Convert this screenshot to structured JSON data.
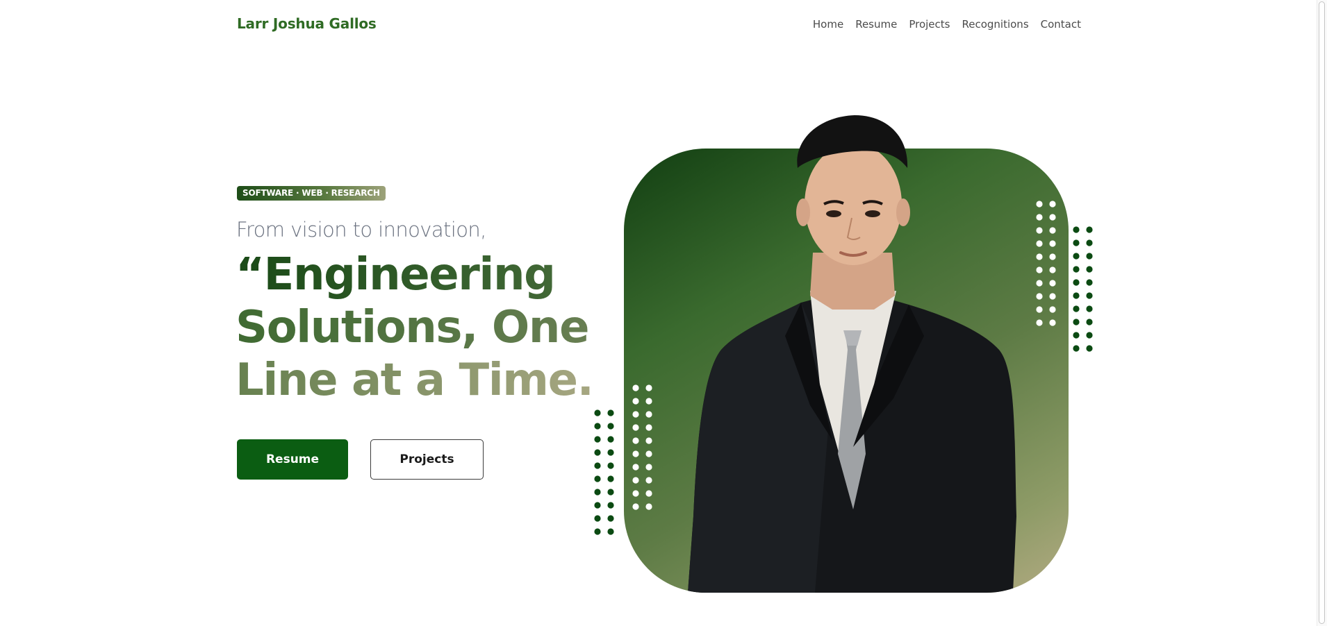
{
  "header": {
    "brand": "Larr Joshua Gallos",
    "nav": [
      "Home",
      "Resume",
      "Projects",
      "Recognitions",
      "Contact"
    ]
  },
  "hero": {
    "tag": "SOFTWARE · WEB · RESEARCH",
    "kicker": "From vision to innovation,",
    "headline": [
      "“Engineering",
      "Solutions, One",
      "Line at a Time.”"
    ],
    "buttons": {
      "primary": "Resume",
      "secondary": "Projects"
    }
  },
  "colors": {
    "brand": "#2f6b24",
    "primary_button": "#0b5d12",
    "card_gradient_start": "#123f12",
    "card_gradient_end": "#b2aa82",
    "dot_dark": "#0b4a12",
    "dot_light": "#ffffff"
  },
  "icons": {
    "portrait": "portrait-photo",
    "decoration": "dot-grid"
  }
}
